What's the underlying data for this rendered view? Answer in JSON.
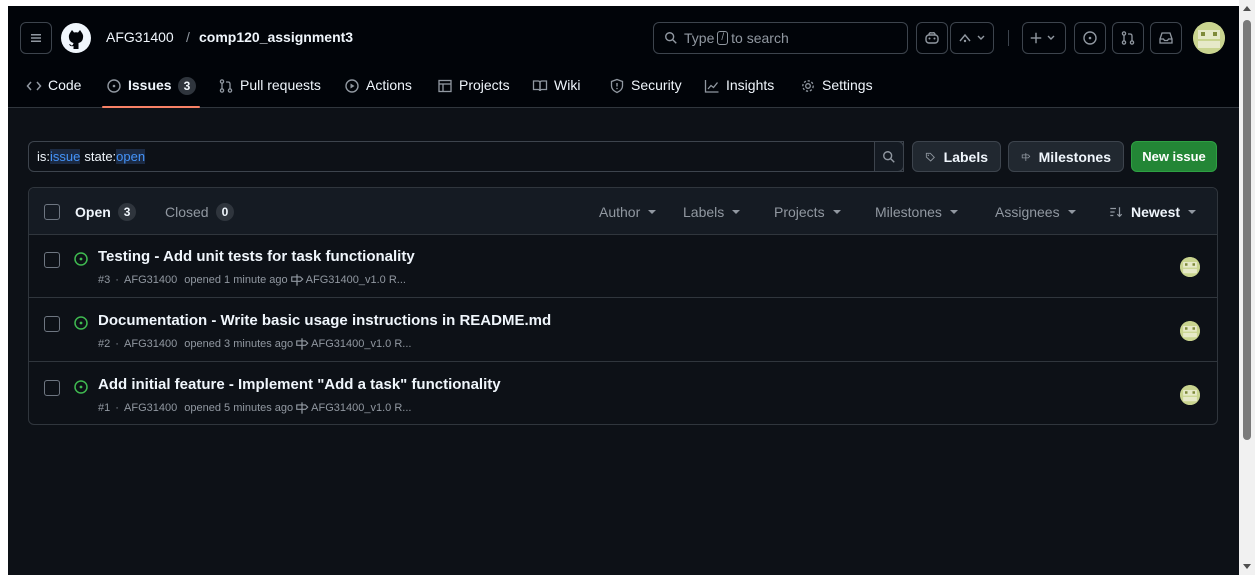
{
  "header": {
    "owner": "AFG31400",
    "separator": "/",
    "repo": "comp120_assignment3",
    "search": {
      "prefix": "Type",
      "key": "/",
      "suffix": "to search"
    }
  },
  "tabs": [
    {
      "label": "Code",
      "icon": "code-icon"
    },
    {
      "label": "Issues",
      "icon": "issue-opened-icon",
      "count": "3",
      "active": true
    },
    {
      "label": "Pull requests",
      "icon": "pull-request-icon"
    },
    {
      "label": "Actions",
      "icon": "play-icon"
    },
    {
      "label": "Projects",
      "icon": "table-icon"
    },
    {
      "label": "Wiki",
      "icon": "book-icon"
    },
    {
      "label": "Security",
      "icon": "shield-icon"
    },
    {
      "label": "Insights",
      "icon": "graph-icon"
    },
    {
      "label": "Settings",
      "icon": "gear-icon"
    }
  ],
  "filter": {
    "token1_key": "is:",
    "token1_value": "issue",
    "token2_key": "state:",
    "token2_value": "open",
    "labels_button": "Labels",
    "milestones_button": "Milestones",
    "new_issue_button": "New issue"
  },
  "list": {
    "open_label": "Open",
    "open_count": "3",
    "closed_label": "Closed",
    "closed_count": "0",
    "menus": [
      "Author",
      "Labels",
      "Projects",
      "Milestones",
      "Assignees"
    ],
    "sort_label": "Newest"
  },
  "issues": [
    {
      "title": "Testing - Add unit tests for task functionality",
      "number": "#3",
      "author": "AFG31400",
      "opened": "opened 1 minute ago",
      "milestone": "AFG31400_v1.0 R..."
    },
    {
      "title": "Documentation - Write basic usage instructions in README.md",
      "number": "#2",
      "author": "AFG31400",
      "opened": "opened 3 minutes ago",
      "milestone": "AFG31400_v1.0 R..."
    },
    {
      "title": "Add initial feature - Implement \"Add a task\" functionality",
      "number": "#1",
      "author": "AFG31400",
      "opened": "opened 5 minutes ago",
      "milestone": "AFG31400_v1.0 R..."
    }
  ],
  "colors": {
    "background": "#0d1117",
    "accent_tab": "#f78166",
    "new_issue_green": "#238636",
    "open_icon_green": "#3fb950",
    "link_blue": "#4493f8"
  }
}
